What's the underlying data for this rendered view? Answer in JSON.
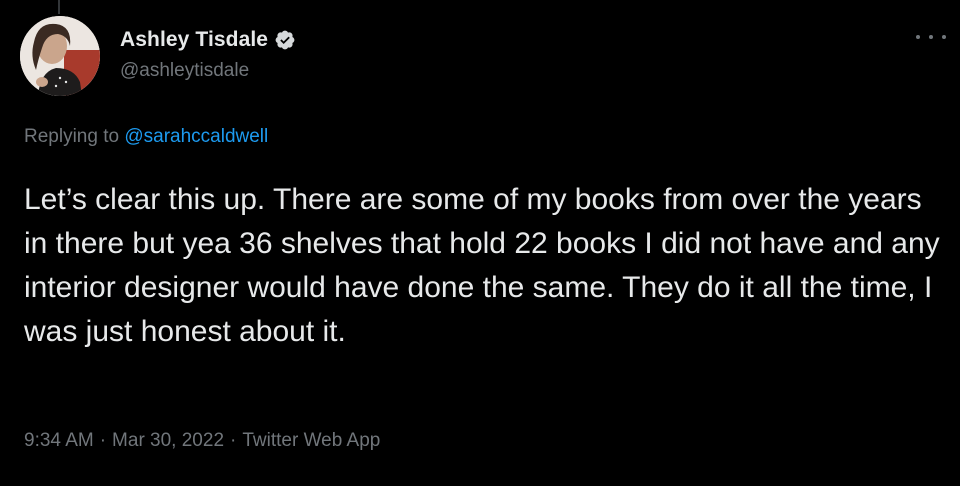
{
  "author": {
    "display_name": "Ashley Tisdale",
    "handle": "@ashleytisdale",
    "verified": true
  },
  "reply": {
    "prefix": "Replying to",
    "mention": "@sarahccaldwell"
  },
  "tweet": {
    "text": "Let’s clear this up. There are some of my books from over the years in there but yea 36 shelves that hold 22 books I did not have and any interior designer would have done the same. They do it all the time, I was just honest about it."
  },
  "meta": {
    "time": "9:34 AM",
    "separator": "·",
    "date": "Mar 30, 2022",
    "source": "Twitter Web App"
  },
  "icons": {
    "verified": "verified-badge-icon",
    "more": "more-options-icon"
  },
  "colors": {
    "background": "#000000",
    "primary_text": "#e7e9ea",
    "secondary_text": "#71767b",
    "link": "#1d9bf0"
  }
}
